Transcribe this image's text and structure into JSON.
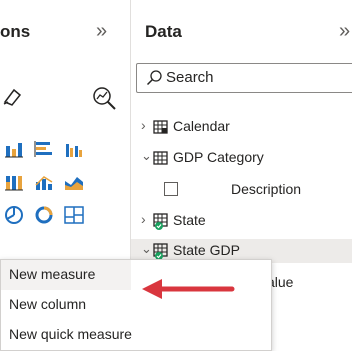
{
  "build_pane": {
    "title_partial": "ons"
  },
  "data_pane": {
    "title": "Data",
    "search": {
      "placeholder": "Search"
    },
    "tree": [
      {
        "label": "Calendar",
        "expanded": false,
        "icon": "calendar-table-icon"
      },
      {
        "label": "GDP Category",
        "expanded": true,
        "icon": "table-icon"
      },
      {
        "label": "Description",
        "type": "field",
        "icon": "checkbox"
      },
      {
        "label": "State",
        "expanded": false,
        "icon": "table-check-icon"
      },
      {
        "label": "State GDP",
        "expanded": true,
        "icon": "table-check-icon",
        "selected": true
      },
      {
        "label": "Value",
        "partial": "n Value",
        "type": "field"
      }
    ]
  },
  "context_menu": {
    "items": [
      {
        "label": "New measure"
      },
      {
        "label": "New column"
      },
      {
        "label": "New quick measure"
      }
    ]
  },
  "colors": {
    "accent_arrow": "#d9363e",
    "check_green": "#1aa260",
    "chart_blue": "#1f6fbf",
    "chart_orange": "#e8a33d"
  }
}
